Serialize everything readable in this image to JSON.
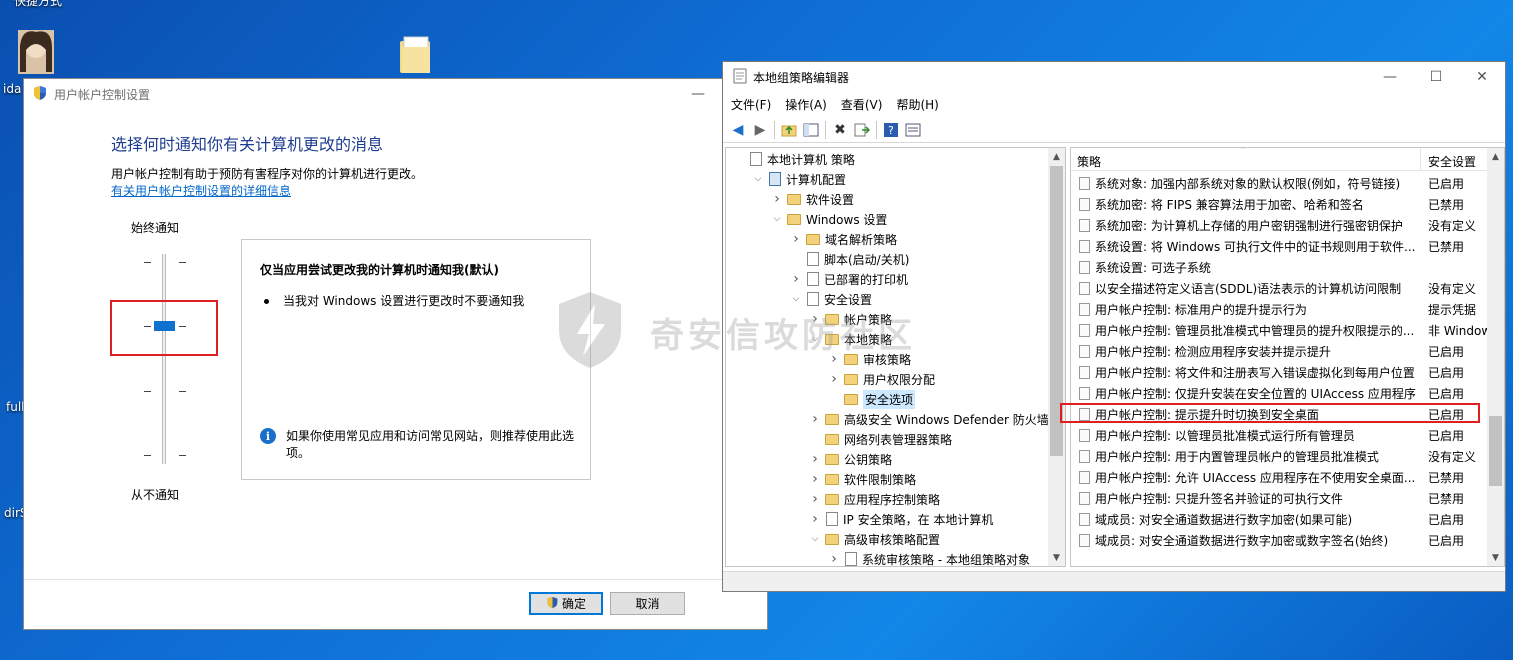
{
  "desktop": {
    "top_label": "快捷方式",
    "left_labels": [
      "ida",
      "full",
      "dirS"
    ]
  },
  "uac": {
    "title": "用户帐户控制设置",
    "heading": "选择何时通知你有关计算机更改的消息",
    "description": "用户帐户控制有助于预防有害程序对你的计算机进行更改。",
    "link": "有关用户帐户控制设置的详细信息",
    "label_top": "始终通知",
    "label_bottom": "从不通知",
    "slider_level": 3,
    "slider_levels_total": 4,
    "panel_title": "仅当应用尝试更改我的计算机时通知我(默认)",
    "panel_bullet": "当我对 Windows 设置进行更改时不要通知我",
    "panel_note": "如果你使用常见应用和访问常见网站，则推荐使用此选项。",
    "ok_label": "确定",
    "cancel_label": "取消"
  },
  "gpe": {
    "title": "本地组策略编辑器",
    "menu": [
      "文件(F)",
      "操作(A)",
      "查看(V)",
      "帮助(H)"
    ],
    "tree": [
      {
        "label": "本地计算机 策略",
        "indent": 0,
        "exp": "",
        "icon": "policy",
        "sel": false
      },
      {
        "label": "计算机配置",
        "indent": 1,
        "exp": "v",
        "icon": "comp",
        "sel": false
      },
      {
        "label": "软件设置",
        "indent": 2,
        "exp": ">",
        "icon": "folder",
        "sel": false
      },
      {
        "label": "Windows 设置",
        "indent": 2,
        "exp": "v",
        "icon": "folder",
        "sel": false
      },
      {
        "label": "域名解析策略",
        "indent": 3,
        "exp": ">",
        "icon": "folder",
        "sel": false
      },
      {
        "label": "脚本(启动/关机)",
        "indent": 3,
        "exp": "",
        "icon": "policy",
        "sel": false
      },
      {
        "label": "已部署的打印机",
        "indent": 3,
        "exp": ">",
        "icon": "policy",
        "sel": false
      },
      {
        "label": "安全设置",
        "indent": 3,
        "exp": "v",
        "icon": "policy",
        "sel": false
      },
      {
        "label": "帐户策略",
        "indent": 4,
        "exp": ">",
        "icon": "folder",
        "sel": false
      },
      {
        "label": "本地策略",
        "indent": 4,
        "exp": "v",
        "icon": "folder",
        "sel": false
      },
      {
        "label": "审核策略",
        "indent": 5,
        "exp": ">",
        "icon": "folder",
        "sel": false
      },
      {
        "label": "用户权限分配",
        "indent": 5,
        "exp": ">",
        "icon": "folder",
        "sel": false
      },
      {
        "label": "安全选项",
        "indent": 5,
        "exp": "",
        "icon": "folder",
        "sel": true
      },
      {
        "label": "高级安全 Windows Defender 防火墙",
        "indent": 4,
        "exp": ">",
        "icon": "folder",
        "sel": false
      },
      {
        "label": "网络列表管理器策略",
        "indent": 4,
        "exp": "",
        "icon": "folder",
        "sel": false
      },
      {
        "label": "公钥策略",
        "indent": 4,
        "exp": ">",
        "icon": "folder",
        "sel": false
      },
      {
        "label": "软件限制策略",
        "indent": 4,
        "exp": ">",
        "icon": "folder",
        "sel": false
      },
      {
        "label": "应用程序控制策略",
        "indent": 4,
        "exp": ">",
        "icon": "folder",
        "sel": false
      },
      {
        "label": "IP 安全策略，在 本地计算机",
        "indent": 4,
        "exp": ">",
        "icon": "policy",
        "sel": false
      },
      {
        "label": "高级审核策略配置",
        "indent": 4,
        "exp": "v",
        "icon": "folder",
        "sel": false
      },
      {
        "label": "系统审核策略 - 本地组策略对象",
        "indent": 5,
        "exp": ">",
        "icon": "policy",
        "sel": false
      }
    ],
    "list_header_policy": "策略",
    "list_header_setting": "安全设置",
    "rows": [
      {
        "policy": "系统对象: 加强内部系统对象的默认权限(例如，符号链接)",
        "setting": "已启用"
      },
      {
        "policy": "系统加密: 将 FIPS 兼容算法用于加密、哈希和签名",
        "setting": "已禁用"
      },
      {
        "policy": "系统加密: 为计算机上存储的用户密钥强制进行强密钥保护",
        "setting": "没有定义"
      },
      {
        "policy": "系统设置: 将 Windows 可执行文件中的证书规则用于软件...",
        "setting": "已禁用"
      },
      {
        "policy": "系统设置: 可选子系统",
        "setting": ""
      },
      {
        "policy": "以安全描述符定义语言(SDDL)语法表示的计算机访问限制",
        "setting": "没有定义"
      },
      {
        "policy": "用户帐户控制: 标准用户的提升提示行为",
        "setting": "提示凭据"
      },
      {
        "policy": "用户帐户控制: 管理员批准模式中管理员的提升权限提示的...",
        "setting": "非 Windows"
      },
      {
        "policy": "用户帐户控制: 检测应用程序安装并提示提升",
        "setting": "已启用"
      },
      {
        "policy": "用户帐户控制: 将文件和注册表写入错误虚拟化到每用户位置",
        "setting": "已启用"
      },
      {
        "policy": "用户帐户控制: 仅提升安装在安全位置的 UIAccess 应用程序",
        "setting": "已启用"
      },
      {
        "policy": "用户帐户控制: 提示提升时切换到安全桌面",
        "setting": "已启用"
      },
      {
        "policy": "用户帐户控制: 以管理员批准模式运行所有管理员",
        "setting": "已启用"
      },
      {
        "policy": "用户帐户控制: 用于内置管理员帐户的管理员批准模式",
        "setting": "没有定义"
      },
      {
        "policy": "用户帐户控制: 允许 UIAccess 应用程序在不使用安全桌面...",
        "setting": "已禁用"
      },
      {
        "policy": "用户帐户控制: 只提升签名并验证的可执行文件",
        "setting": "已禁用"
      },
      {
        "policy": "域成员: 对安全通道数据进行数字加密(如果可能)",
        "setting": "已启用"
      },
      {
        "policy": "域成员: 对安全通道数据进行数字加密或数字签名(始终)",
        "setting": "已启用"
      }
    ]
  },
  "watermark": {
    "text": "奇安信攻防社区"
  },
  "colors": {
    "accent": "#0078d7",
    "highlight": "#e02020",
    "heading": "#1e3d8f",
    "link": "#0066cc"
  }
}
